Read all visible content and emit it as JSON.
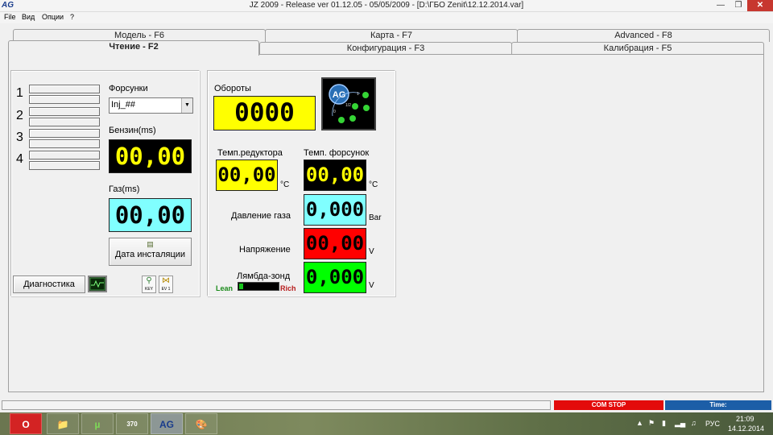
{
  "window": {
    "app_icon": "AG",
    "title": "JZ 2009  - Release  ver 01.12.05 - 05/05/2009  - [D:\\ГБО Zenit\\12.12.2014.var]",
    "minimize_icon": "minimize-icon",
    "maximize_icon": "maximize-icon",
    "close_icon": "close-icon"
  },
  "menu": {
    "file": "File",
    "view": "Вид",
    "options": "Опции",
    "help": "?"
  },
  "tabs": {
    "model": "Модель - F6",
    "map": "Карта - F7",
    "advanced": "Advanced - F8",
    "read": "Чтение - F2",
    "config": "Конфигурация - F3",
    "calibration": "Калибрация - F5"
  },
  "left_panel": {
    "injector_numbers": [
      "1",
      "2",
      "3",
      "4"
    ],
    "injectors_label": "Форсунки",
    "injector_select_value": "Inj_##",
    "petrol_label": "Бензин(ms)",
    "petrol_value": "00,00",
    "gas_label": "Газ(ms)",
    "gas_value": "00,00",
    "install_date_label": "Дата инсталяции",
    "diagnostics_label": "Диагностика",
    "key_label": "KEY",
    "ev_label": "EV 1"
  },
  "right_panel": {
    "rpm_label": "Обороты",
    "rpm_value": "0000",
    "logo_text": "AG",
    "logo_scale_labels": [
      "0",
      "1/2",
      "1"
    ],
    "reducer_temp_label": "Темп.редуктора",
    "reducer_temp_value": "00,00",
    "reducer_temp_unit": "°C",
    "injector_temp_label": "Темп. форсунок",
    "injector_temp_value": "00,00",
    "injector_temp_unit": "°C",
    "gas_pressure_label": "Давление газа",
    "gas_pressure_value": "0,000",
    "gas_pressure_unit": "Bar",
    "voltage_label": "Напряжение",
    "voltage_value": "00,00",
    "voltage_unit": "V",
    "lambda_label": "Лямбда-зонд",
    "lambda_value": "0,000",
    "lambda_unit": "V",
    "lean_label": "Lean",
    "rich_label": "Rich",
    "lambda_bar_level": 0.1
  },
  "status": {
    "com": "COM STOP",
    "time": "Time:"
  },
  "taskbar": {
    "lang": "РУС",
    "clock_time": "21:09",
    "clock_date": "14.12.2014",
    "video_badge": "370",
    "active_app": "AG"
  },
  "colors": {
    "lcd_yellow": "#ffff00",
    "lcd_cyan": "#80ffff",
    "lcd_red": "#ff0000",
    "lcd_green": "#00ff00",
    "lcd_black": "#000000",
    "com_stop": "#e30b0b",
    "time_bar": "#1c5ea7"
  }
}
